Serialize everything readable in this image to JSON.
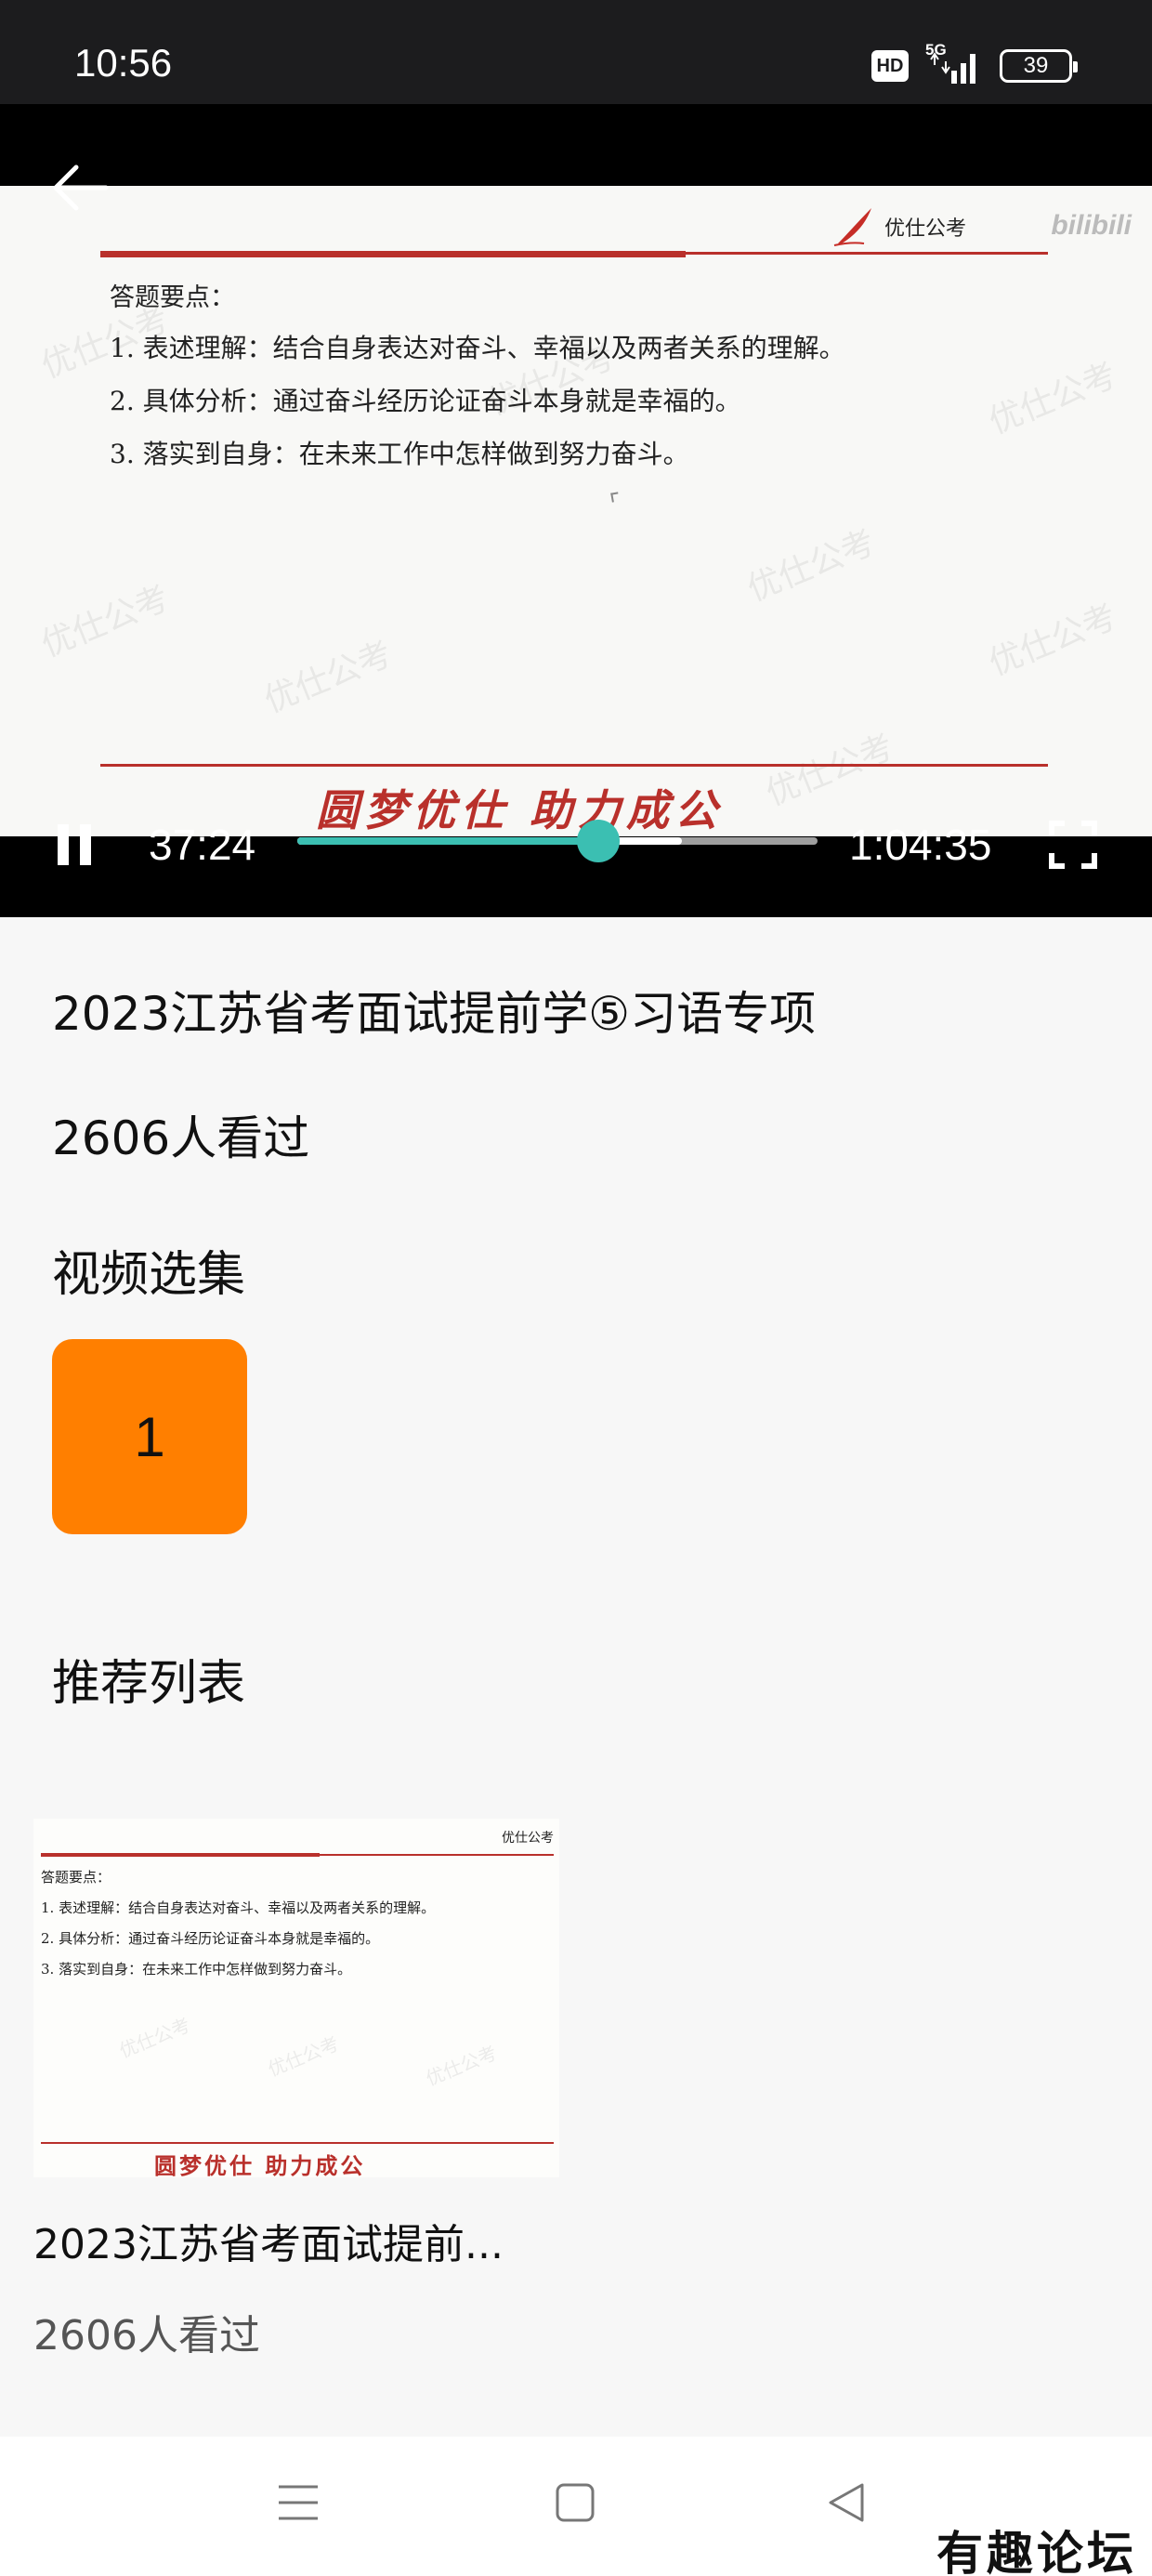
{
  "status_bar": {
    "time": "10:56",
    "hd": "HD",
    "network": "5G",
    "battery": "39"
  },
  "player": {
    "back": "back-arrow-icon",
    "slide": {
      "logo_text": "优仕公考",
      "watermark": "bilibili",
      "heading": "答题要点：",
      "points": [
        "1. 表述理解：结合自身表达对奋斗、幸福以及两者关系的理解。",
        "2. 具体分析：通过奋斗经历论证奋斗本身就是幸福的。",
        "3. 落实到自身：在未来工作中怎样做到努力奋斗。"
      ],
      "slogan": "圆梦优仕   助力成公"
    },
    "current_time": "37:24",
    "duration": "1:04:35",
    "progress": 0.579,
    "buffered": 0.74,
    "accent_color": "#3bbfb2"
  },
  "video": {
    "title": "2023江苏省考面试提前学⑤习语专项",
    "views": "2606人看过"
  },
  "episodes": {
    "title": "视频选集",
    "items": [
      "1"
    ],
    "selected_color": "#ff7f00"
  },
  "recommend": {
    "title": "推荐列表",
    "items": [
      {
        "title": "2023江苏省考面试提前...",
        "views": "2606人看过",
        "thumb": {
          "logo_text": "优仕公考",
          "heading": "答题要点：",
          "points": [
            "1. 表述理解：结合自身表达对奋斗、幸福以及两者关系的理解。",
            "2. 具体分析：通过奋斗经历论证奋斗本身就是幸福的。",
            "3. 落实到自身：在未来工作中怎样做到努力奋斗。"
          ],
          "slogan": "圆梦优仕   助力成公"
        }
      }
    ]
  },
  "nav_bar": {
    "buttons": [
      "menu-icon",
      "home-icon",
      "back-triangle-icon"
    ]
  },
  "forum_mark": "有趣论坛"
}
